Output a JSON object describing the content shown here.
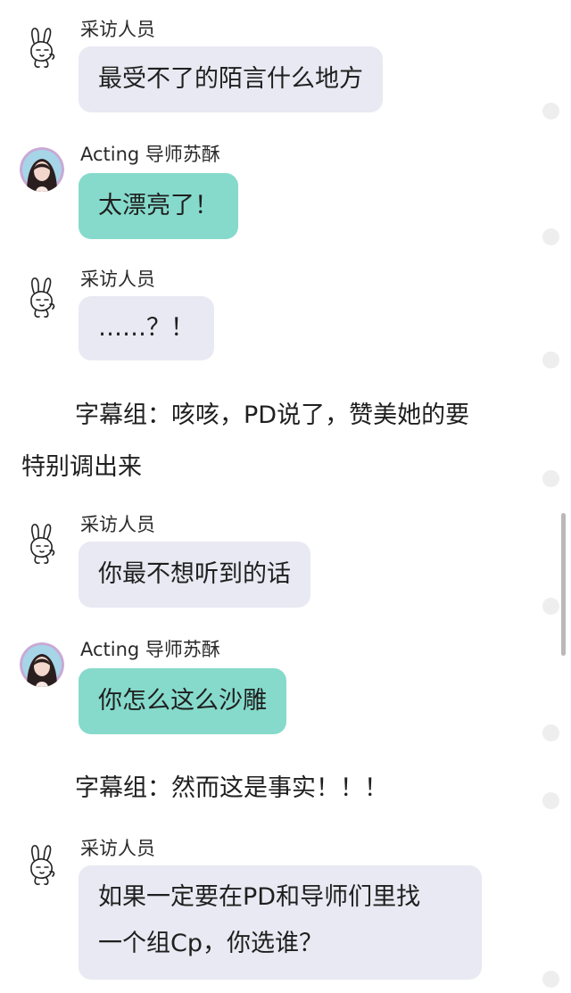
{
  "messages": [
    {
      "sender": "采访人员",
      "text": "最受不了的陌言什么地方"
    },
    {
      "sender": "Acting 导师苏酥",
      "text": "太漂亮了！"
    },
    {
      "sender": "采访人员",
      "text": "……？！"
    },
    {
      "sender": "采访人员",
      "text": "你最不想听到的话"
    },
    {
      "sender": "Acting 导师苏酥",
      "text": "你怎么这么沙雕"
    },
    {
      "sender": "采访人员",
      "text_line1": "如果一定要在PD和导师们里找",
      "text_line2": "一个组Cp，你选谁？"
    }
  ],
  "captions": {
    "caption1_line1": "字幕组：咳咳，PD说了，赞美她的要",
    "caption1_line2": "特别调出来",
    "caption2": "字幕组：然而这是事实！！！"
  },
  "colors": {
    "gray_bubble": "#e8e9f2",
    "teal_bubble": "#86dacb"
  },
  "icons": {
    "interviewer": "rabbit-avatar-icon",
    "mentor": "girl-photo-avatar"
  }
}
